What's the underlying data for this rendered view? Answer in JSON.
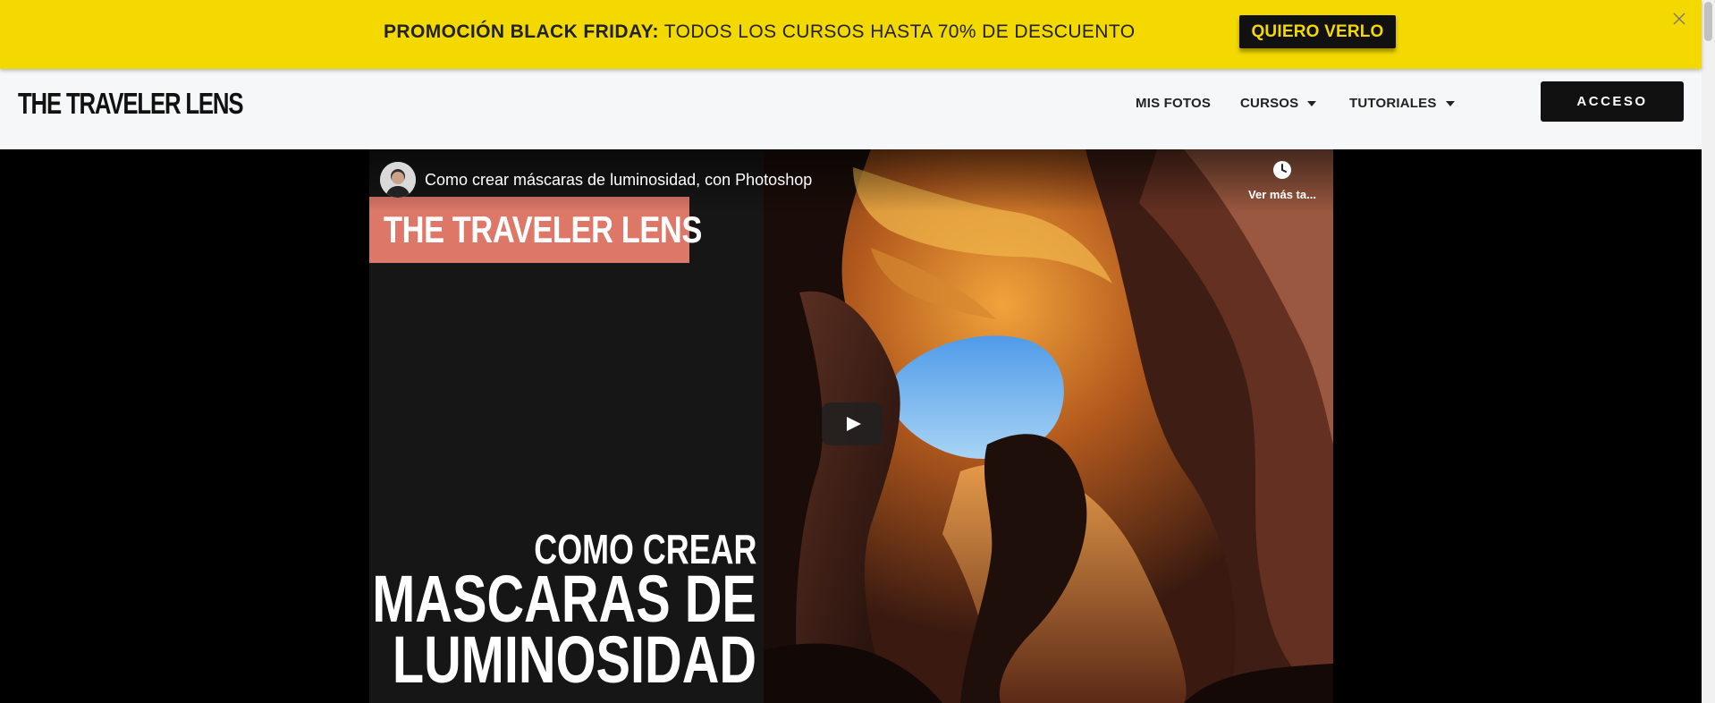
{
  "promo": {
    "bold_text": "PROMOCIÓN BLACK FRIDAY:",
    "text": " TODOS LOS CURSOS HASTA 70% DE DESCUENTO",
    "cta_label": "QUIERO VERLO",
    "close_icon": "close-icon",
    "background_color": "#f3d900"
  },
  "header": {
    "logo": "THE TRAVELER LENS",
    "nav": [
      {
        "label": "MIS FOTOS",
        "dropdown": false
      },
      {
        "label": "CURSOS",
        "dropdown": true
      },
      {
        "label": "TUTORIALES",
        "dropdown": true
      }
    ],
    "login_label": "ACCESO"
  },
  "video": {
    "title": "Como crear máscaras de luminosidad, con Photoshop",
    "watch_later_label": "Ver más ta...",
    "watch_later_icon": "clock-icon",
    "play_icon": "play-icon",
    "thumbnail": {
      "brand": "THE TRAVELER LENS",
      "line1": "COMO CREAR",
      "line2": "MASCARAS DE",
      "line3": "LUMINOSIDAD",
      "brand_color": "#dd7868"
    }
  }
}
